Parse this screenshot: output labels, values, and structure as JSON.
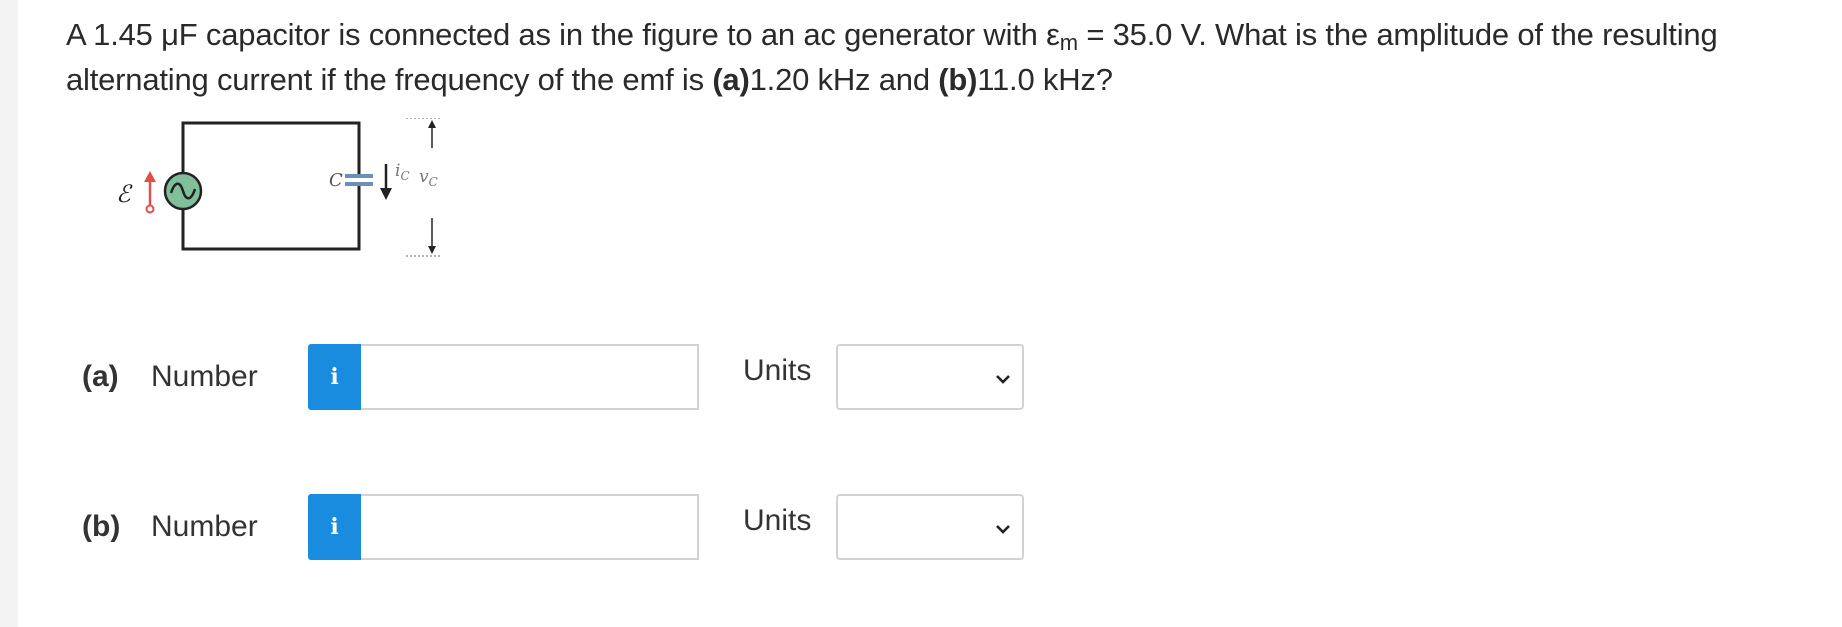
{
  "question": {
    "part1": "A 1.45 μF capacitor is connected as in the figure to an ac generator with ε",
    "sub": "m",
    "part2": " = 35.0 V. What is the amplitude of the resulting alternating current if the frequency of the emf is ",
    "a_label": "(a)",
    "a_value": "1.20 kHz and ",
    "b_label": "(b)",
    "b_value": "11.0 kHz?"
  },
  "figure": {
    "emf_symbol": "ℰ",
    "capacitor_label": "C",
    "current_label": "i",
    "current_sub": "C",
    "voltage_label": "v",
    "voltage_sub": "C",
    "colors": {
      "source_fill": "#7fbf9a",
      "arrow_red": "#e0504a",
      "capacitor_blue": "#6b8fb8",
      "wire": "#222222"
    }
  },
  "answers": [
    {
      "part": "(a)",
      "number_label": "Number",
      "info_icon": "i",
      "value": "",
      "units_label": "Units",
      "units_selected": ""
    },
    {
      "part": "(b)",
      "number_label": "Number",
      "info_icon": "i",
      "value": "",
      "units_label": "Units",
      "units_selected": ""
    }
  ],
  "colors": {
    "info_button": "#1a8ce0",
    "input_border": "#d2d2d2",
    "text": "#2a2a2a"
  }
}
